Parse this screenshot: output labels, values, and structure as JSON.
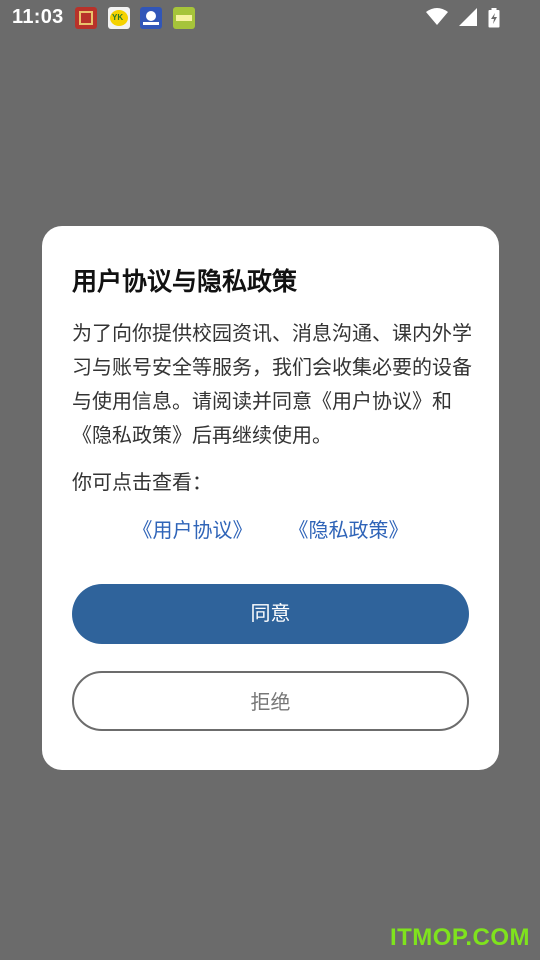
{
  "status_bar": {
    "time": "11:03",
    "notification_icons": [
      "app-icon-red",
      "app-icon-yk",
      "app-icon-blue",
      "app-icon-green"
    ],
    "system_icons": [
      "wifi-icon",
      "signal-icon",
      "battery-charging-icon"
    ]
  },
  "dialog": {
    "title": "用户协议与隐私政策",
    "body": "为了向你提供校园资讯、消息沟通、课内外学习与账号安全等服务，我们会收集必要的设备与使用信息。请阅读并同意《用户协议》和《隐私政策》后再继续使用。",
    "view_label": "你可点击查看：",
    "links": {
      "user_agreement": "《用户协议》",
      "privacy_policy": "《隐私政策》"
    },
    "agree_label": "同意",
    "reject_label": "拒绝"
  },
  "watermark": "ITMOP.COM",
  "colors": {
    "overlay": "#6b6b6b",
    "primary": "#2f639b",
    "link": "#2f64b8",
    "watermark": "#7fe31d"
  }
}
